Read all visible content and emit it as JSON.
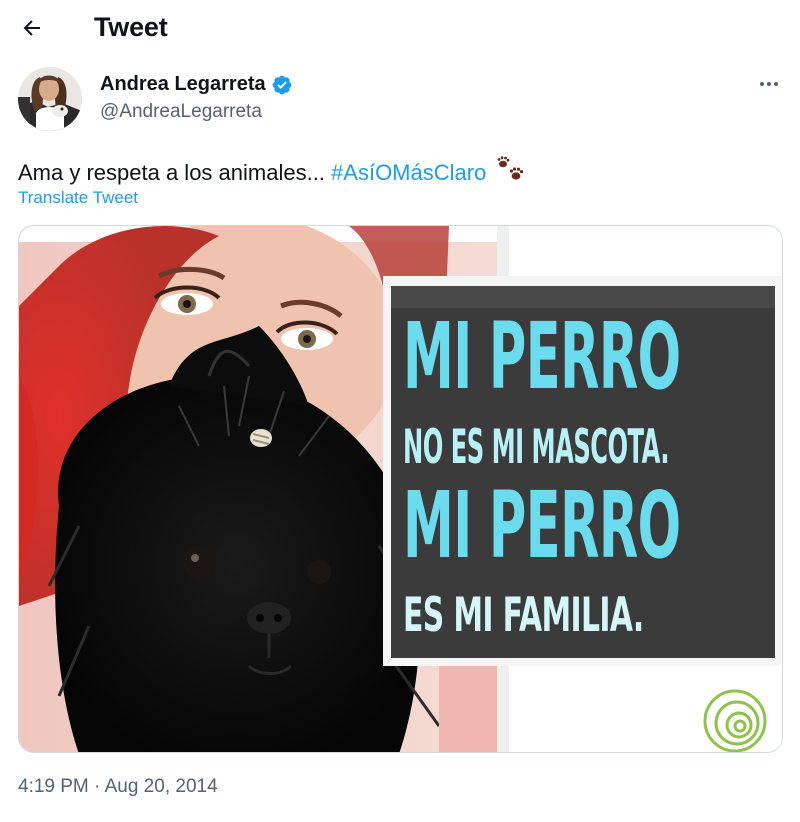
{
  "header": {
    "back_icon": "arrow-left-icon",
    "title": "Tweet"
  },
  "author": {
    "display_name": "Andrea Legarreta",
    "handle": "@AndreaLegarreta",
    "verified_icon": "verified-badge-icon",
    "more_icon": "more-horizontal-icon"
  },
  "tweet": {
    "text": "Ama y respeta a los animales...",
    "hashtag": "#AsíOMásClaro",
    "emoji_icon": "paw-prints-icon",
    "translate_label": "Translate Tweet",
    "timestamp": "4:19 PM · Aug 20, 2014"
  },
  "media": {
    "line1": "MI PERRO",
    "line2": "NO ES MI MASCOTA.",
    "line3": "MI PERRO",
    "line4": "ES MI FAMILIA."
  },
  "colors": {
    "accent": "#1d9bf0",
    "text": "#0f1419",
    "secondary": "#536471",
    "border": "#cfd9de",
    "meme_text": "#6adcee"
  }
}
